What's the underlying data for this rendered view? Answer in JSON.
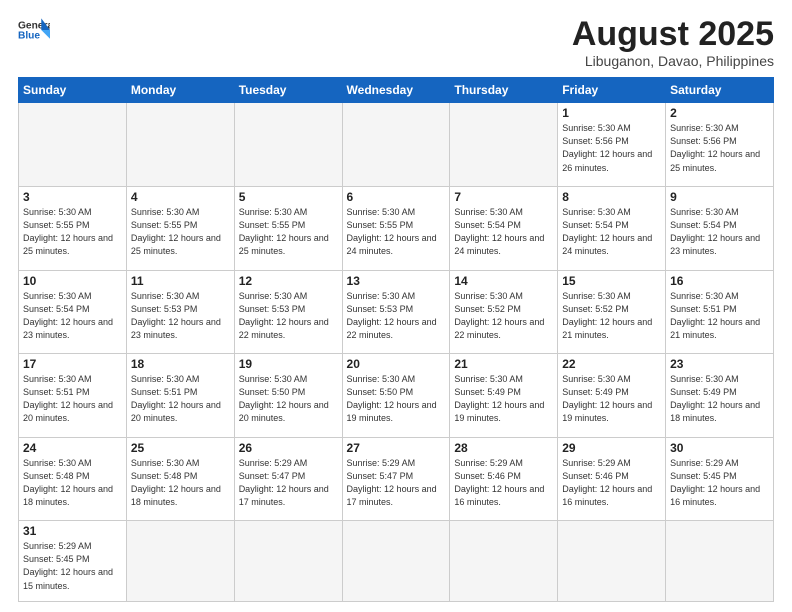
{
  "header": {
    "logo_general": "General",
    "logo_blue": "Blue",
    "month_title": "August 2025",
    "subtitle": "Libuganon, Davao, Philippines"
  },
  "weekdays": [
    "Sunday",
    "Monday",
    "Tuesday",
    "Wednesday",
    "Thursday",
    "Friday",
    "Saturday"
  ],
  "weeks": [
    [
      {
        "day": "",
        "info": ""
      },
      {
        "day": "",
        "info": ""
      },
      {
        "day": "",
        "info": ""
      },
      {
        "day": "",
        "info": ""
      },
      {
        "day": "",
        "info": ""
      },
      {
        "day": "1",
        "info": "Sunrise: 5:30 AM\nSunset: 5:56 PM\nDaylight: 12 hours and 26 minutes."
      },
      {
        "day": "2",
        "info": "Sunrise: 5:30 AM\nSunset: 5:56 PM\nDaylight: 12 hours and 25 minutes."
      }
    ],
    [
      {
        "day": "3",
        "info": "Sunrise: 5:30 AM\nSunset: 5:55 PM\nDaylight: 12 hours and 25 minutes."
      },
      {
        "day": "4",
        "info": "Sunrise: 5:30 AM\nSunset: 5:55 PM\nDaylight: 12 hours and 25 minutes."
      },
      {
        "day": "5",
        "info": "Sunrise: 5:30 AM\nSunset: 5:55 PM\nDaylight: 12 hours and 25 minutes."
      },
      {
        "day": "6",
        "info": "Sunrise: 5:30 AM\nSunset: 5:55 PM\nDaylight: 12 hours and 24 minutes."
      },
      {
        "day": "7",
        "info": "Sunrise: 5:30 AM\nSunset: 5:54 PM\nDaylight: 12 hours and 24 minutes."
      },
      {
        "day": "8",
        "info": "Sunrise: 5:30 AM\nSunset: 5:54 PM\nDaylight: 12 hours and 24 minutes."
      },
      {
        "day": "9",
        "info": "Sunrise: 5:30 AM\nSunset: 5:54 PM\nDaylight: 12 hours and 23 minutes."
      }
    ],
    [
      {
        "day": "10",
        "info": "Sunrise: 5:30 AM\nSunset: 5:54 PM\nDaylight: 12 hours and 23 minutes."
      },
      {
        "day": "11",
        "info": "Sunrise: 5:30 AM\nSunset: 5:53 PM\nDaylight: 12 hours and 23 minutes."
      },
      {
        "day": "12",
        "info": "Sunrise: 5:30 AM\nSunset: 5:53 PM\nDaylight: 12 hours and 22 minutes."
      },
      {
        "day": "13",
        "info": "Sunrise: 5:30 AM\nSunset: 5:53 PM\nDaylight: 12 hours and 22 minutes."
      },
      {
        "day": "14",
        "info": "Sunrise: 5:30 AM\nSunset: 5:52 PM\nDaylight: 12 hours and 22 minutes."
      },
      {
        "day": "15",
        "info": "Sunrise: 5:30 AM\nSunset: 5:52 PM\nDaylight: 12 hours and 21 minutes."
      },
      {
        "day": "16",
        "info": "Sunrise: 5:30 AM\nSunset: 5:51 PM\nDaylight: 12 hours and 21 minutes."
      }
    ],
    [
      {
        "day": "17",
        "info": "Sunrise: 5:30 AM\nSunset: 5:51 PM\nDaylight: 12 hours and 20 minutes."
      },
      {
        "day": "18",
        "info": "Sunrise: 5:30 AM\nSunset: 5:51 PM\nDaylight: 12 hours and 20 minutes."
      },
      {
        "day": "19",
        "info": "Sunrise: 5:30 AM\nSunset: 5:50 PM\nDaylight: 12 hours and 20 minutes."
      },
      {
        "day": "20",
        "info": "Sunrise: 5:30 AM\nSunset: 5:50 PM\nDaylight: 12 hours and 19 minutes."
      },
      {
        "day": "21",
        "info": "Sunrise: 5:30 AM\nSunset: 5:49 PM\nDaylight: 12 hours and 19 minutes."
      },
      {
        "day": "22",
        "info": "Sunrise: 5:30 AM\nSunset: 5:49 PM\nDaylight: 12 hours and 19 minutes."
      },
      {
        "day": "23",
        "info": "Sunrise: 5:30 AM\nSunset: 5:49 PM\nDaylight: 12 hours and 18 minutes."
      }
    ],
    [
      {
        "day": "24",
        "info": "Sunrise: 5:30 AM\nSunset: 5:48 PM\nDaylight: 12 hours and 18 minutes."
      },
      {
        "day": "25",
        "info": "Sunrise: 5:30 AM\nSunset: 5:48 PM\nDaylight: 12 hours and 18 minutes."
      },
      {
        "day": "26",
        "info": "Sunrise: 5:29 AM\nSunset: 5:47 PM\nDaylight: 12 hours and 17 minutes."
      },
      {
        "day": "27",
        "info": "Sunrise: 5:29 AM\nSunset: 5:47 PM\nDaylight: 12 hours and 17 minutes."
      },
      {
        "day": "28",
        "info": "Sunrise: 5:29 AM\nSunset: 5:46 PM\nDaylight: 12 hours and 16 minutes."
      },
      {
        "day": "29",
        "info": "Sunrise: 5:29 AM\nSunset: 5:46 PM\nDaylight: 12 hours and 16 minutes."
      },
      {
        "day": "30",
        "info": "Sunrise: 5:29 AM\nSunset: 5:45 PM\nDaylight: 12 hours and 16 minutes."
      }
    ],
    [
      {
        "day": "31",
        "info": "Sunrise: 5:29 AM\nSunset: 5:45 PM\nDaylight: 12 hours and 15 minutes."
      },
      {
        "day": "",
        "info": ""
      },
      {
        "day": "",
        "info": ""
      },
      {
        "day": "",
        "info": ""
      },
      {
        "day": "",
        "info": ""
      },
      {
        "day": "",
        "info": ""
      },
      {
        "day": "",
        "info": ""
      }
    ]
  ]
}
